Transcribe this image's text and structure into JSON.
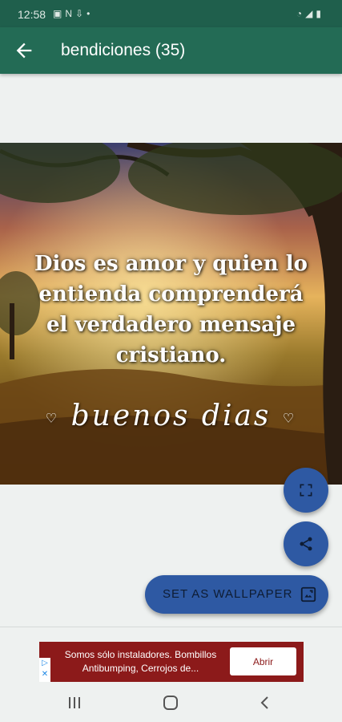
{
  "status_bar": {
    "time": "12:58",
    "left_icons": [
      "image-icon",
      "n-icon",
      "download-icon",
      "dot-icon"
    ],
    "right_icons": [
      "wifi-icon",
      "signal-icon",
      "battery-icon"
    ]
  },
  "app_bar": {
    "title": "bendiciones (35)",
    "back_icon": "arrow-back-icon",
    "background": "#236b55"
  },
  "wallpaper": {
    "quote_lines": [
      "Dios es amor y quien lo",
      "entienda comprenderá",
      "el verdadero mensaje",
      "cristiano."
    ],
    "greeting": "buenos dias"
  },
  "actions": {
    "fullscreen_icon": "fullscreen-icon",
    "share_icon": "share-icon",
    "set_wallpaper_label": "SET AS WALLPAPER",
    "set_wallpaper_icon": "wallpaper-icon",
    "accent": "#2e59a3"
  },
  "ad": {
    "text": "Somos sólo instaladores. Bombillos Antibumping, Cerrojos de...",
    "button_label": "Abrir",
    "background": "#8c1a1a"
  },
  "nav_bar": {
    "recents_icon": "recents-icon",
    "home_icon": "home-icon",
    "back_icon": "back-icon"
  }
}
